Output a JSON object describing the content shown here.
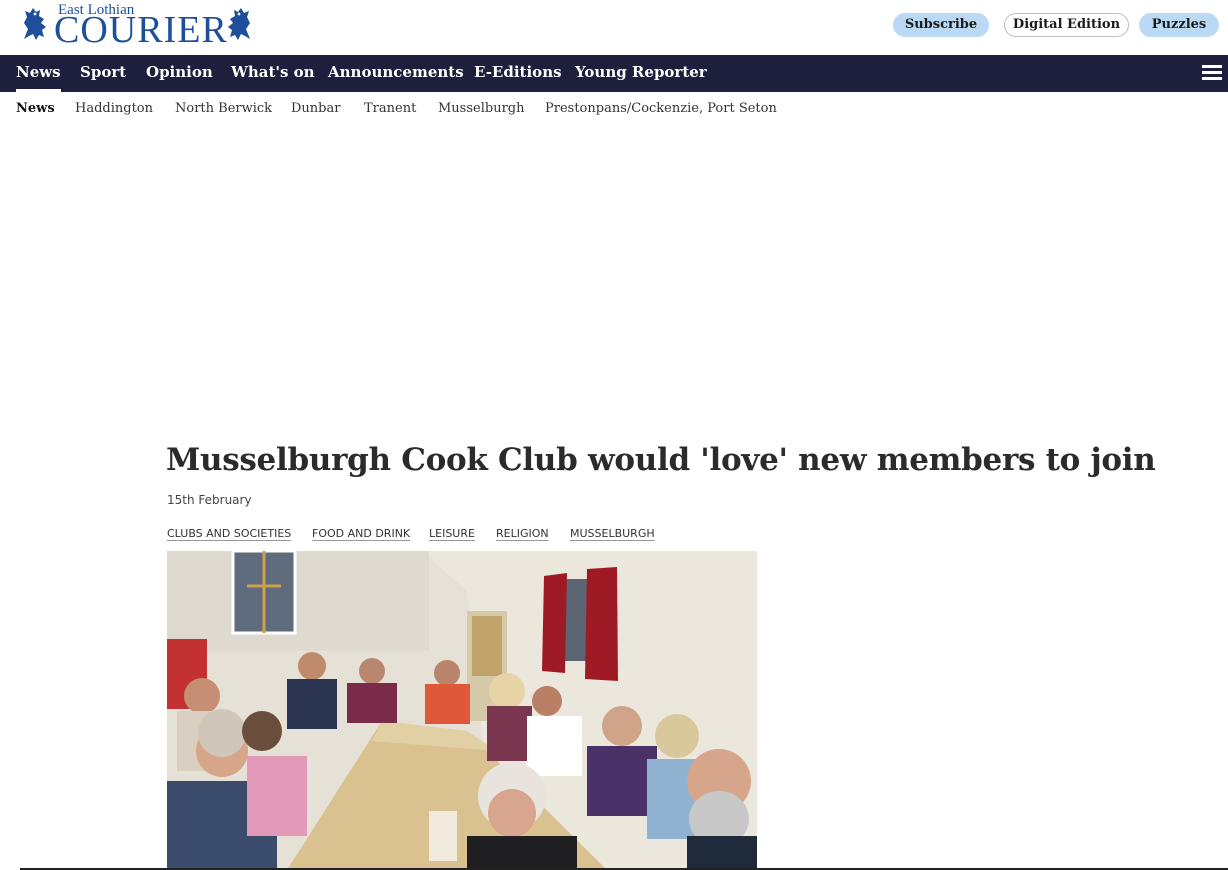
{
  "header": {
    "logo_small": "East Lothian",
    "logo_big": "COURIER",
    "subscribe_label": "Subscribe",
    "digital_label": "Digital Edition",
    "puzzles_label": "Puzzles"
  },
  "mainnav": {
    "items": [
      "News",
      "Sport",
      "Opinion",
      "What's on",
      "Announcements",
      "E-Editions",
      "Young Reporter"
    ],
    "active": "News"
  },
  "subnav": {
    "items": [
      "News",
      "Haddington",
      "North Berwick",
      "Dunbar",
      "Tranent",
      "Musselburgh",
      "Prestonpans/Cockenzie, Port Seton"
    ],
    "active": "News"
  },
  "article": {
    "headline": "Musselburgh Cook Club would 'love' new members to join",
    "date": "15th February",
    "tags": [
      "CLUBS AND SOCIETIES",
      "FOOD AND DRINK",
      "LEISURE",
      "RELIGION",
      "MUSSELBURGH"
    ]
  },
  "colors": {
    "brand_blue": "#1d4f9b",
    "nav_bg": "#1e1f3c",
    "pill_blue": "#b9d9f5"
  },
  "icons": {
    "logo": "lion-rampant-icon",
    "menu": "hamburger-menu-icon"
  }
}
